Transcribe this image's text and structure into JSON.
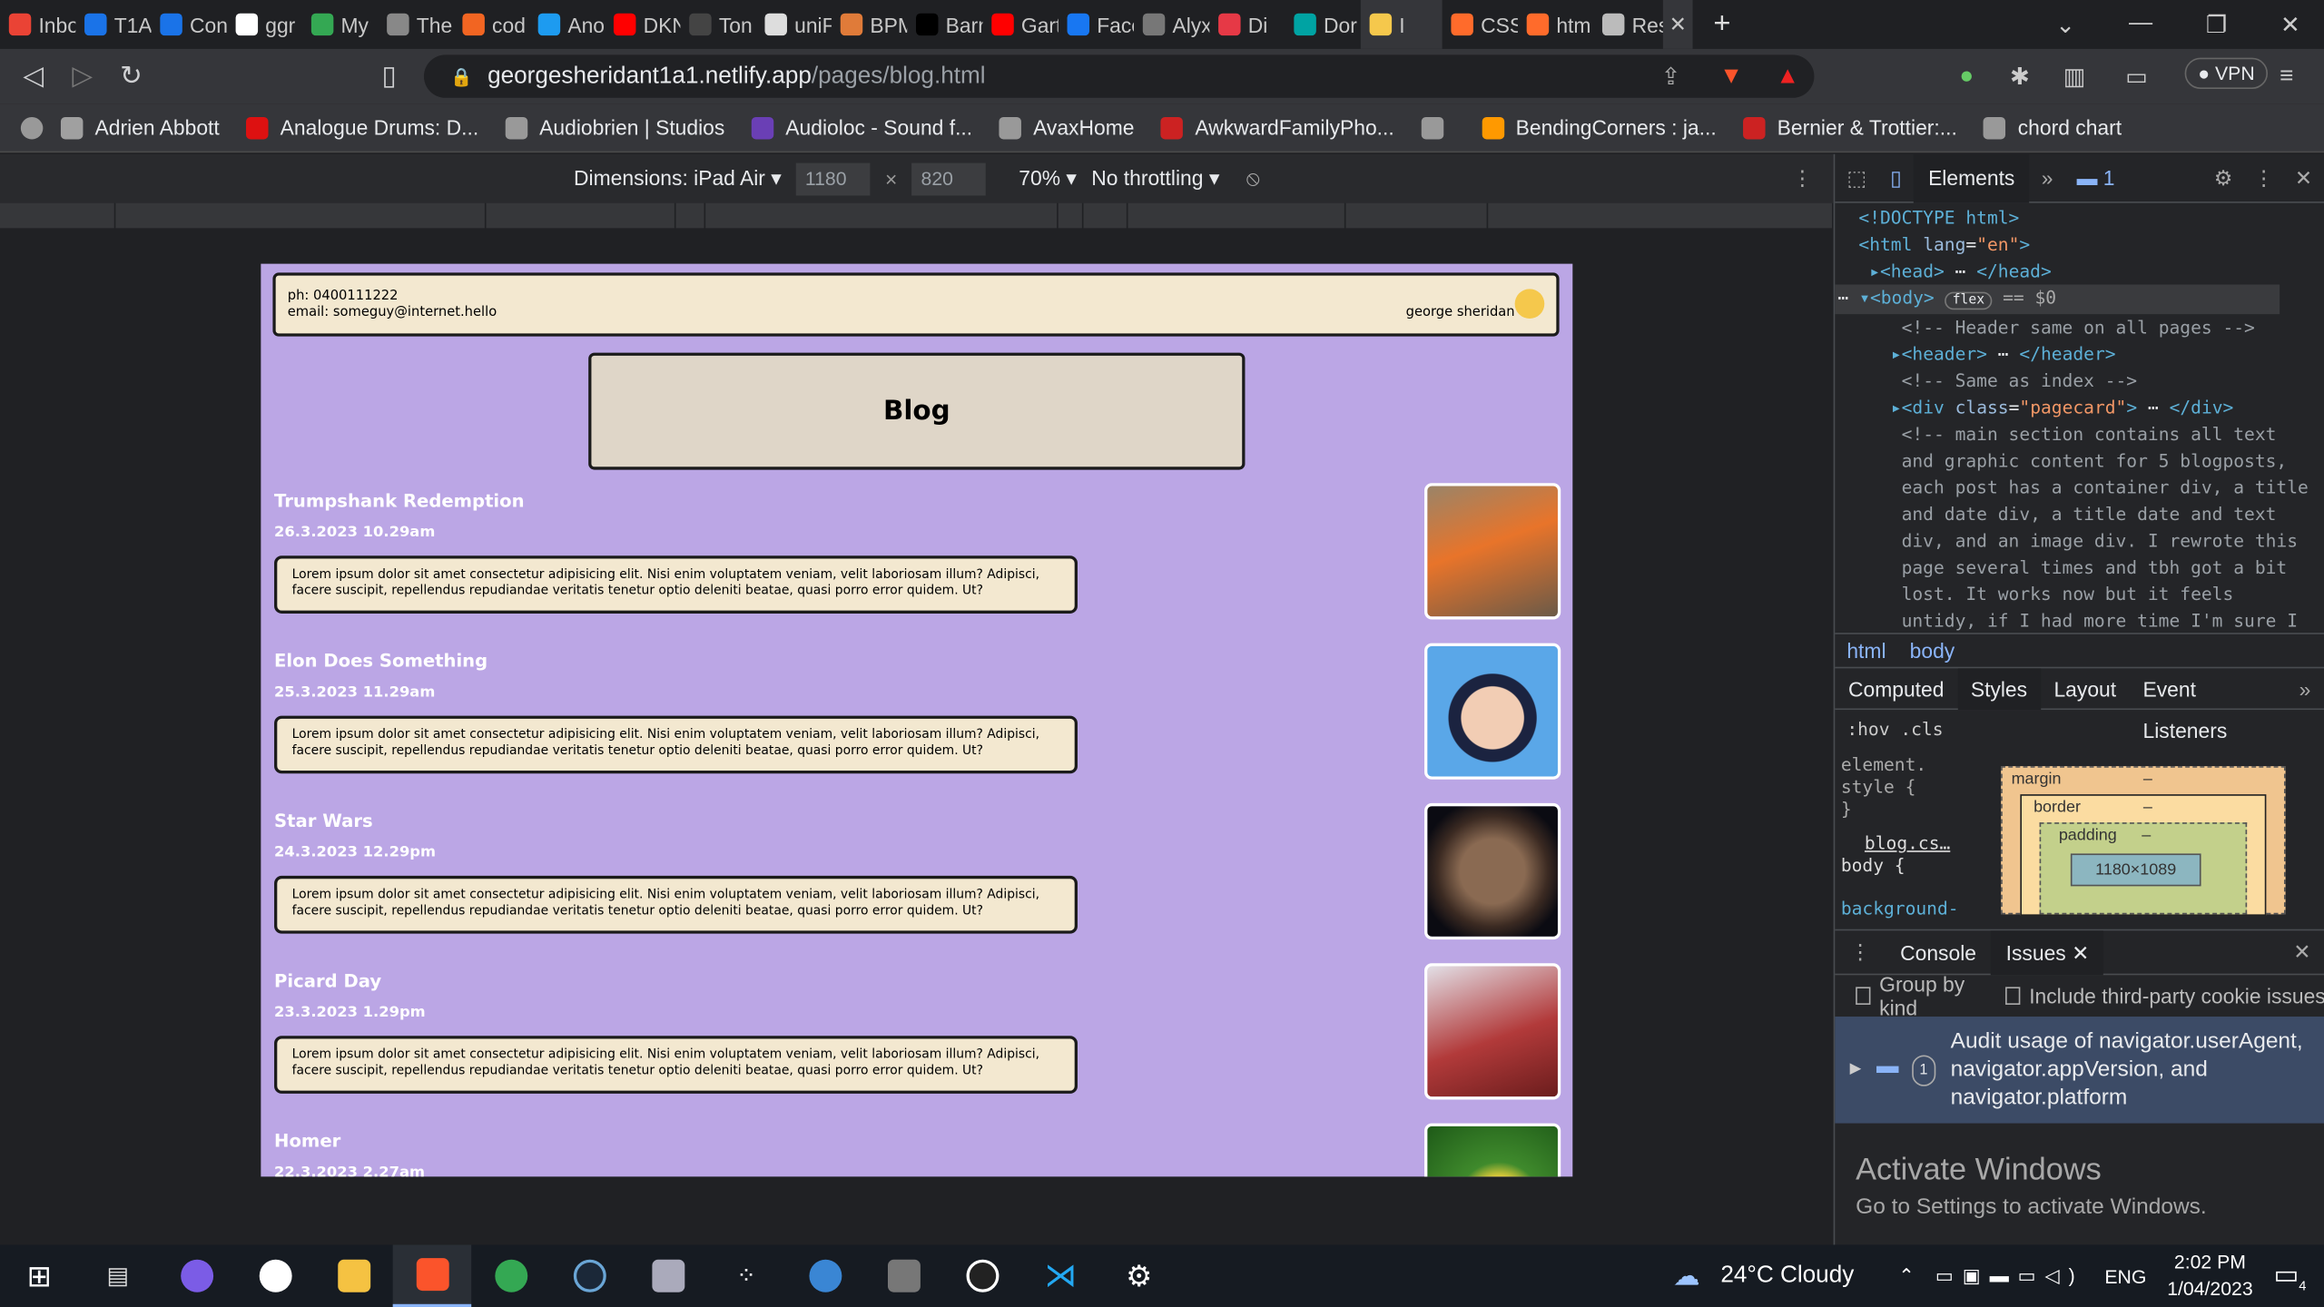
{
  "tabs": [
    {
      "label": "Inbo",
      "color": "#ea4335"
    },
    {
      "label": "T1A",
      "color": "#1a73e8"
    },
    {
      "label": "Con",
      "color": "#1a73e8"
    },
    {
      "label": "ggr",
      "color": "#ffffff"
    },
    {
      "label": "My",
      "color": "#34a853"
    },
    {
      "label": "The",
      "color": "#888888"
    },
    {
      "label": "cod",
      "color": "#f26522"
    },
    {
      "label": "Ano",
      "color": "#1d9bf0"
    },
    {
      "label": "DKN",
      "color": "#ff0000"
    },
    {
      "label": "Ton",
      "color": "#444444"
    },
    {
      "label": "uniF",
      "color": "#dddddd"
    },
    {
      "label": "BPM",
      "color": "#e07b39"
    },
    {
      "label": "Barr",
      "color": "#000000"
    },
    {
      "label": "Gart",
      "color": "#ff0000"
    },
    {
      "label": "Face",
      "color": "#1877f2"
    },
    {
      "label": "Alyx",
      "color": "#777777"
    },
    {
      "label": "Di",
      "color": "#e63946"
    },
    {
      "label": "Dor",
      "color": "#00a3a3"
    },
    {
      "label": "I",
      "color": "#f5c84c"
    },
    {
      "label": "CSS",
      "color": "#ff6b2b"
    },
    {
      "label": "htm",
      "color": "#ff6b2b"
    },
    {
      "label": "Resu",
      "color": "#bbbbbb"
    }
  ],
  "address": {
    "host": "georgesheridant1a1.netlify.app",
    "path": "/pages/blog.html"
  },
  "vpn_label": "VPN",
  "bookmarks": [
    {
      "label": "Adrien Abbott",
      "color": "#a0a0a0"
    },
    {
      "label": "Analogue Drums: D...",
      "color": "#d11"
    },
    {
      "label": "Audiobrien | Studios",
      "color": "#999"
    },
    {
      "label": "Audioloc - Sound f...",
      "color": "#6a3fb5"
    },
    {
      "label": "AvaxHome",
      "color": "#999"
    },
    {
      "label": "AwkwardFamilyPho...",
      "color": "#c22"
    },
    {
      "label": "",
      "color": "#999"
    },
    {
      "label": "BendingCorners : ja...",
      "color": "#f90"
    },
    {
      "label": "Bernier & Trottier:...",
      "color": "#c22"
    },
    {
      "label": "chord chart",
      "color": "#999"
    }
  ],
  "device": {
    "dimensions": "Dimensions: iPad Air",
    "width": "1180",
    "height": "820",
    "zoom": "70%",
    "throttle": "No throttling"
  },
  "site": {
    "phone": "ph: 0400111222",
    "email": "email: someguy@internet.hello",
    "name": "george sheridan",
    "heading": "Blog",
    "lorem": "Lorem ipsum dolor sit amet consectetur adipisicing elit. Nisi enim voluptatem veniam, velit laboriosam illum? Adipisci, facere suscipit, repellendus repudiandae veritatis tenetur optio deleniti beatae, quasi porro error quidem. Ut?",
    "posts": [
      {
        "title": "Trumpshank Redemption",
        "date": "26.3.2023 10.29am"
      },
      {
        "title": "Elon Does Something",
        "date": "25.3.2023 11.29am"
      },
      {
        "title": "Star Wars",
        "date": "24.3.2023 12.29pm"
      },
      {
        "title": "Picard Day",
        "date": "23.3.2023 1.29pm"
      },
      {
        "title": "Homer",
        "date": "22.3.2023 2.27am"
      }
    ]
  },
  "devtools": {
    "tab_elements": "Elements",
    "issues_count": "1",
    "breadcrumb": [
      "html",
      "body"
    ],
    "style_tabs": [
      "Computed",
      "Styles",
      "Layout",
      "Event Listeners"
    ],
    "filter": ":hov  .cls",
    "element_style": "element.",
    "element_style2": "style {",
    "close_brace": "}",
    "rule_source": "blog.cs…",
    "rule_selector": "body {",
    "rule_prop": "background-",
    "box_margin": "margin",
    "box_border": "border",
    "box_padding": "padding",
    "box_size": "1180×1089",
    "dash": "–",
    "drawer_tabs": [
      "Console",
      "Issues"
    ],
    "group_by_kind": "Group by kind",
    "third_party": "Include third-party cookie issues",
    "issue_text": "Audit usage of navigator.userAgent, navigator.appVersion, and navigator.platform",
    "issue_count": "1",
    "activate_title": "Activate Windows",
    "activate_sub": "Go to Settings to activate Windows."
  },
  "taskbar": {
    "weather": "24°C  Cloudy",
    "lang": "ENG",
    "time": "2:02 PM",
    "date": "1/04/2023",
    "notif": "4"
  }
}
